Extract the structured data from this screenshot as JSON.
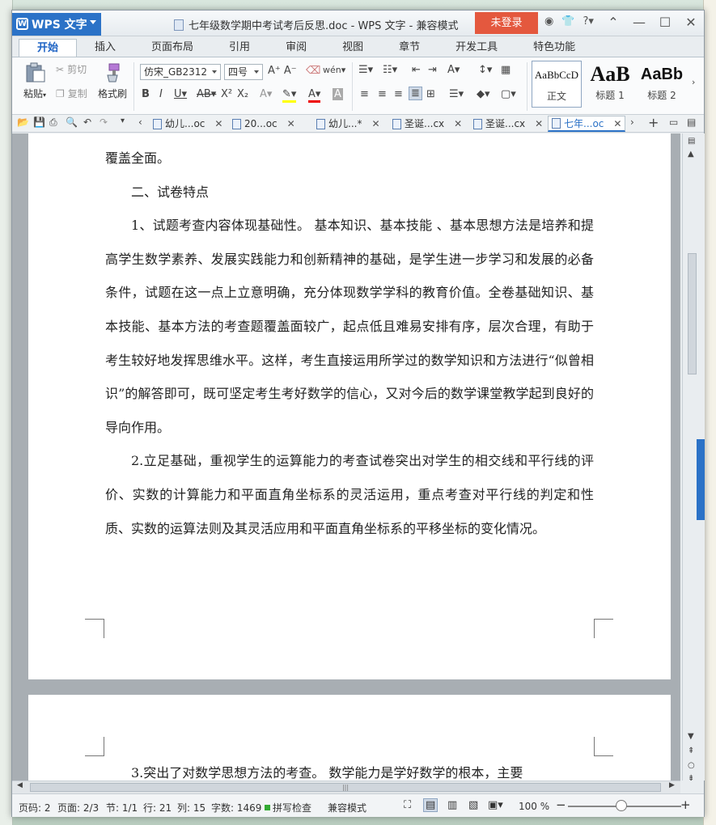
{
  "app": {
    "name": "WPS 文字",
    "title": "七年级数学期中考试考后反思.doc - WPS 文字 - 兼容模式",
    "login": "未登录"
  },
  "tabs": [
    "开始",
    "插入",
    "页面布局",
    "引用",
    "审阅",
    "视图",
    "章节",
    "开发工具",
    "特色功能"
  ],
  "clipboard": {
    "paste": "粘贴",
    "cut": "剪切",
    "copy": "复制",
    "format_painter": "格式刷"
  },
  "font": {
    "name": "仿宋_GB2312",
    "size": "四号"
  },
  "styles": [
    {
      "sample": "AaBbCcD",
      "label": "正文"
    },
    {
      "sample": "AaB",
      "label": "标题 1"
    },
    {
      "sample": "AaBb",
      "label": "标题 2"
    }
  ],
  "doc_tabs": [
    "幼儿...oc",
    "20...oc",
    "幼儿...*",
    "圣诞...cx",
    "圣诞...cx",
    "七年...oc"
  ],
  "document": {
    "p0": "覆盖全面。",
    "p1": "二、试卷特点",
    "p2": "1、试题考查内容体现基础性。 基本知识、基本技能 、基本思想方法是培养和提高学生数学素养、发展实践能力和创新精神的基础，是学生进一步学习和发展的必备条件，试题在这一点上立意明确，充分体现数学学科的教育价值。全卷基础知识、基本技能、基本方法的考查题覆盖面较广，起点低且难易安排有序，层次合理，有助于考生较好地发挥思维水平。这样，考生直接运用所学过的数学知识和方法进行“似曾相识”的解答即可，既可坚定考生考好数学的信心，又对今后的数学课堂教学起到良好的导向作用。",
    "p3": "2.立足基础，重视学生的运算能力的考查试卷突出对学生的相交线和平行线的评价、实数的计算能力和平面直角坐标系的灵活运用，重点考查对平行线的判定和性质、实数的运算法则及其灵活应用和平面直角坐标系的平移坐标的变化情况。",
    "p4": "3.突出了对数学思想方法的考查。 数学能力是学好数学的根本，主要"
  },
  "status": {
    "page_num": "页码: 2",
    "pages": "页面: 2/3",
    "section": "节: 1/1",
    "row": "行: 21",
    "col": "列: 15",
    "words": "字数: 1469",
    "spell": "拼写检查",
    "mode": "兼容模式",
    "zoom": "100 %"
  }
}
